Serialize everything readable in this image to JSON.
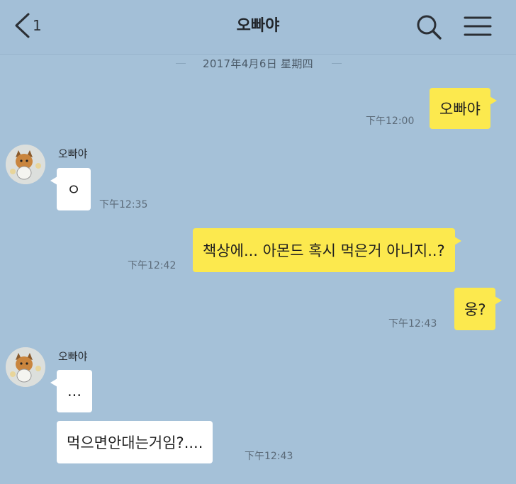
{
  "header": {
    "back_count": "1",
    "title": "오빠야",
    "icons": [
      "chevron-left-icon",
      "search-icon",
      "menu-icon"
    ]
  },
  "date_separator": "2017年4月6日 星期四",
  "messages": [
    {
      "side": "right",
      "text": "오빠야",
      "time": "下午12:00"
    },
    {
      "side": "left",
      "sender": "오빠야",
      "text": "ㅇ",
      "time": "下午12:35"
    },
    {
      "side": "right",
      "text": "책상에... 아몬드 혹시 먹은거 아니지..?",
      "time": "下午12:42"
    },
    {
      "side": "right",
      "text": "웅?",
      "time": "下午12:43"
    },
    {
      "side": "left",
      "sender": "오빠야",
      "text": "...",
      "time": ""
    },
    {
      "side": "left",
      "text": "먹으면안대는거임?....",
      "time": "下午12:43"
    }
  ],
  "colors": {
    "background": "#a5c1d8",
    "my_bubble": "#fce94e",
    "their_bubble": "#ffffff"
  }
}
